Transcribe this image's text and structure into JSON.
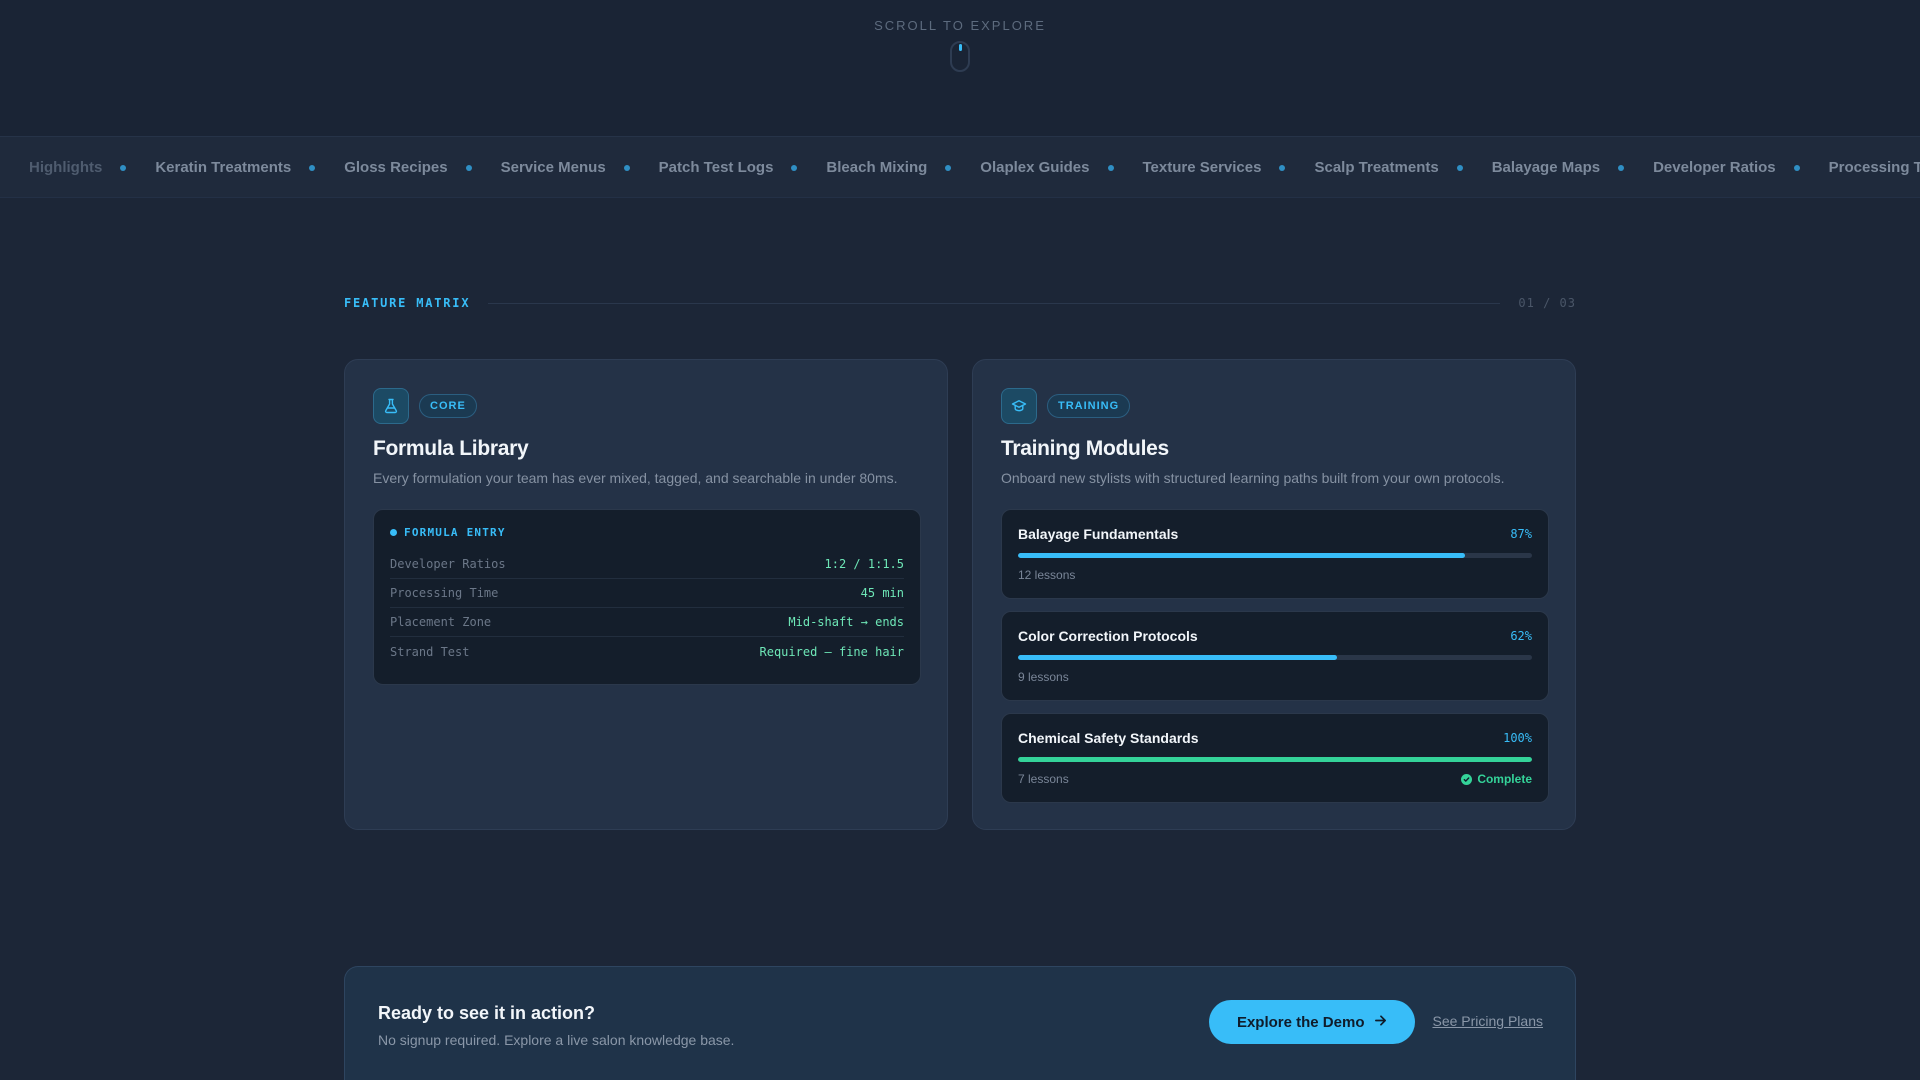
{
  "hero": {
    "scroll_hint": "SCROLL TO EXPLORE"
  },
  "marquee": {
    "items": [
      "Highlights",
      "Keratin Treatments",
      "Gloss Recipes",
      "Service Menus",
      "Patch Test Logs",
      "Bleach Mixing",
      "Olaplex Guides",
      "Texture Services",
      "Scalp Treatments",
      "Balayage Maps",
      "Developer Ratios",
      "Processing Ti"
    ]
  },
  "section": {
    "label": "FEATURE MATRIX",
    "counter": "01 / 03"
  },
  "formula_card": {
    "badge": "CORE",
    "icon": "flask-icon",
    "title": "Formula Library",
    "description": "Every formulation your team has ever mixed, tagged, and searchable in under 80ms.",
    "entry_label": "FORMULA ENTRY",
    "rows": [
      {
        "key": "Developer Ratios",
        "value": "1:2 / 1:1.5"
      },
      {
        "key": "Processing Time",
        "value": "45 min"
      },
      {
        "key": "Placement Zone",
        "value": "Mid-shaft → ends"
      },
      {
        "key": "Strand Test",
        "value": "Required — fine hair"
      }
    ]
  },
  "training_card": {
    "badge": "TRAINING",
    "icon": "graduation-cap-icon",
    "title": "Training Modules",
    "description": "Onboard new stylists with structured learning paths built from your own protocols.",
    "modules": [
      {
        "name": "Balayage Fundamentals",
        "percent_label": "87%",
        "progress": 87,
        "lessons": "12 lessons"
      },
      {
        "name": "Color Correction Protocols",
        "percent_label": "62%",
        "progress": 62,
        "lessons": "9 lessons"
      },
      {
        "name": "Chemical Safety Standards",
        "percent_label": "100%",
        "progress": 100,
        "lessons": "7 lessons",
        "status": "Complete"
      }
    ]
  },
  "cta": {
    "title": "Ready to see it in action?",
    "subtitle": "No signup required. Explore a live salon knowledge base.",
    "primary_label": "Explore the Demo",
    "secondary_label": "See Pricing Plans"
  },
  "colors": {
    "accent": "#38bdf8",
    "success": "#34d399",
    "background": "#1c2637",
    "card": "#243247"
  }
}
